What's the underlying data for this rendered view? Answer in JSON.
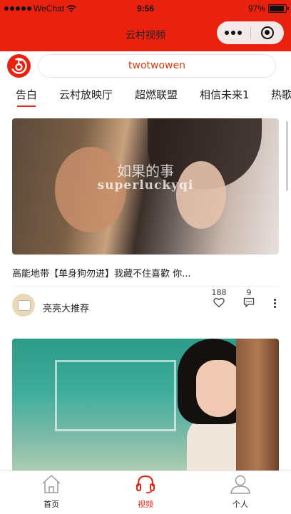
{
  "status_bar": {
    "carrier": "WeChat",
    "time": "9:56",
    "battery_percent": "97%",
    "battery_level": 0.97
  },
  "nav": {
    "title": "云村视频"
  },
  "search": {
    "placeholder": "twotwowen"
  },
  "tabs": [
    {
      "label": "告白",
      "active": true
    },
    {
      "label": "云村放映厅",
      "active": false
    },
    {
      "label": "超燃联盟",
      "active": false
    },
    {
      "label": "相信未来1",
      "active": false
    },
    {
      "label": "热歌",
      "active": false
    }
  ],
  "videos": [
    {
      "overlay_title": "如果的事",
      "overlay_subtitle": "superluckyqi",
      "title": "高能地带【单身狗勿进】我藏不住喜歡 你...",
      "author": "亮亮大推荐",
      "likes": "188",
      "comments": "9"
    },
    {
      "overlay_title": "",
      "overlay_subtitle": "",
      "title": "",
      "author": "",
      "likes": "",
      "comments": ""
    }
  ],
  "tabbar": {
    "items": [
      {
        "label": "首页",
        "icon": "home-icon",
        "active": false
      },
      {
        "label": "视频",
        "icon": "headset-icon",
        "active": true
      },
      {
        "label": "个人",
        "icon": "person-icon",
        "active": false
      }
    ]
  },
  "colors": {
    "brand_red": "#e9210f",
    "search_text": "#d4380d"
  }
}
